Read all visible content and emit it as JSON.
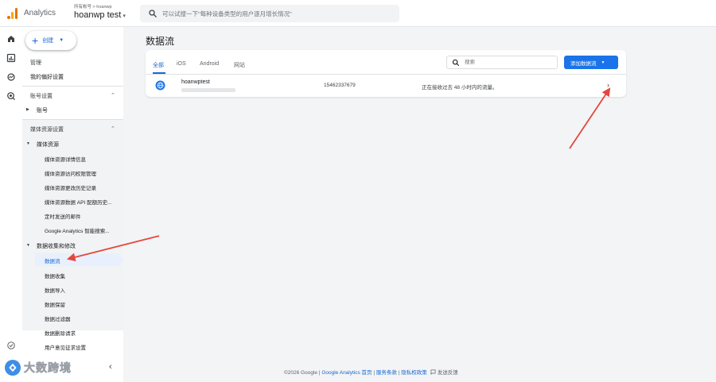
{
  "header": {
    "app_name": "Analytics",
    "account_crumb": "所有帐号 > hoanwp",
    "property_name": "hoanwp test",
    "property_caret": "▾",
    "search_placeholder": "可以试搜一下\"每种设备类型的用户逐月增长情况\""
  },
  "sidebar": {
    "create_label": "创建",
    "admin": "管理",
    "my_prefs": "我的偏好设置",
    "account_settings": "账号设置",
    "account": "账号",
    "property_settings": "媒体资源设置",
    "property": "媒体资源",
    "property_items": [
      "媒体资源详情信息",
      "媒体资源访问权限管理",
      "媒体资源更改历史记录",
      "媒体资源数据 API 配额历史...",
      "定时发送的邮件",
      "Google Analytics 智能搜索..."
    ],
    "data_collection": "数据收集和修改",
    "data_items": [
      "数据流",
      "数据收集",
      "数据导入",
      "数据保留",
      "数据过滤器",
      "数据删除请求",
      "用户意见征求设置"
    ],
    "collapse_icon": "‹"
  },
  "main": {
    "title": "数据流",
    "tabs": [
      "全部",
      "iOS",
      "Android",
      "网站"
    ],
    "search_placeholder": "搜索",
    "add_stream_label": "添加数据流",
    "stream": {
      "name": "hoanwptest",
      "id": "15462337679",
      "status": "正在接收过去 48 小时内的流量。"
    },
    "row_chevron": "›"
  },
  "footer": {
    "copyright": "©2026 Google",
    "sep": " | ",
    "home": "Google Analytics 首页",
    "terms": "服务条款",
    "privacy": "隐私权政策",
    "feedback": "发送反馈"
  },
  "watermark": {
    "text": "大数跨境"
  },
  "colors": {
    "accent": "#1a73e8",
    "link": "#1967d2",
    "annotation_arrow": "#e5473e"
  }
}
